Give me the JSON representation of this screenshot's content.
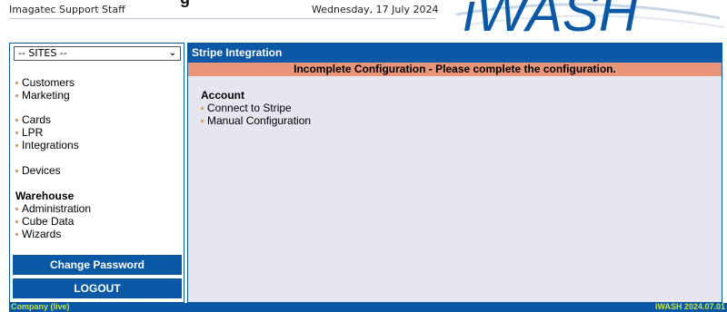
{
  "header": {
    "title_tail": "g",
    "user_role": "Imagatec Support Staff",
    "date": "Wednesday, 17 July 2024",
    "logo_text": "iWASH"
  },
  "sidebar": {
    "site_select": {
      "value": "-- SITES --",
      "icon": "chevron-down-icon"
    },
    "groups": [
      {
        "items": [
          "Customers",
          "Marketing"
        ]
      },
      {
        "items": [
          "Cards",
          "LPR",
          "Integrations"
        ]
      },
      {
        "items": [
          "Devices"
        ]
      },
      {
        "heading": "Warehouse",
        "items": [
          "Administration",
          "Cube Data",
          "Wizards"
        ]
      }
    ],
    "change_password_label": "Change Password",
    "logout_label": "LOGOUT"
  },
  "main": {
    "title": "Stripe Integration",
    "alert": "Incomplete Configuration - Please complete the configuration.",
    "section_heading": "Account",
    "links": [
      "Connect to Stripe",
      "Manual Configuration"
    ]
  },
  "footer": {
    "company": "Company (live)",
    "version": "iWASH 2024.07.01"
  },
  "colors": {
    "primary": "#0b59a6",
    "alert_bg": "#e8957a",
    "panel_bg": "#e6e6f0",
    "bullet": "#e6a13a",
    "footer_text": "#c7e34a"
  }
}
